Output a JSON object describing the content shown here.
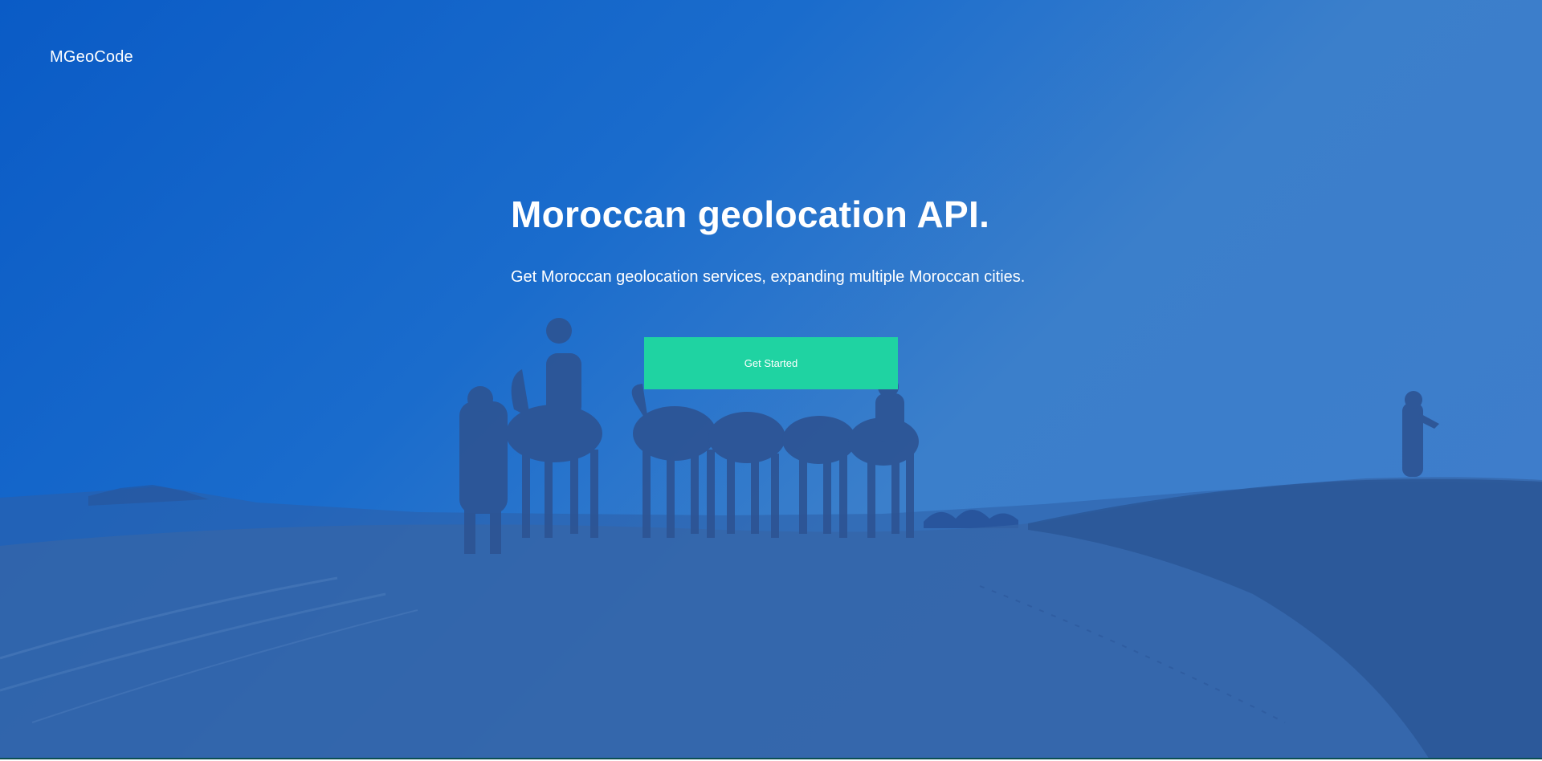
{
  "header": {
    "brand": "MGeoCode"
  },
  "hero": {
    "title": "Moroccan geolocation API.",
    "subtitle": "Get Moroccan geolocation services, expanding multiple Moroccan cities.",
    "cta_label": "Get Started"
  },
  "colors": {
    "overlay_blue": "#0a5bc6",
    "cta_green": "#1fd3a2"
  },
  "background": {
    "icon": "desert-camel-caravan-image"
  }
}
